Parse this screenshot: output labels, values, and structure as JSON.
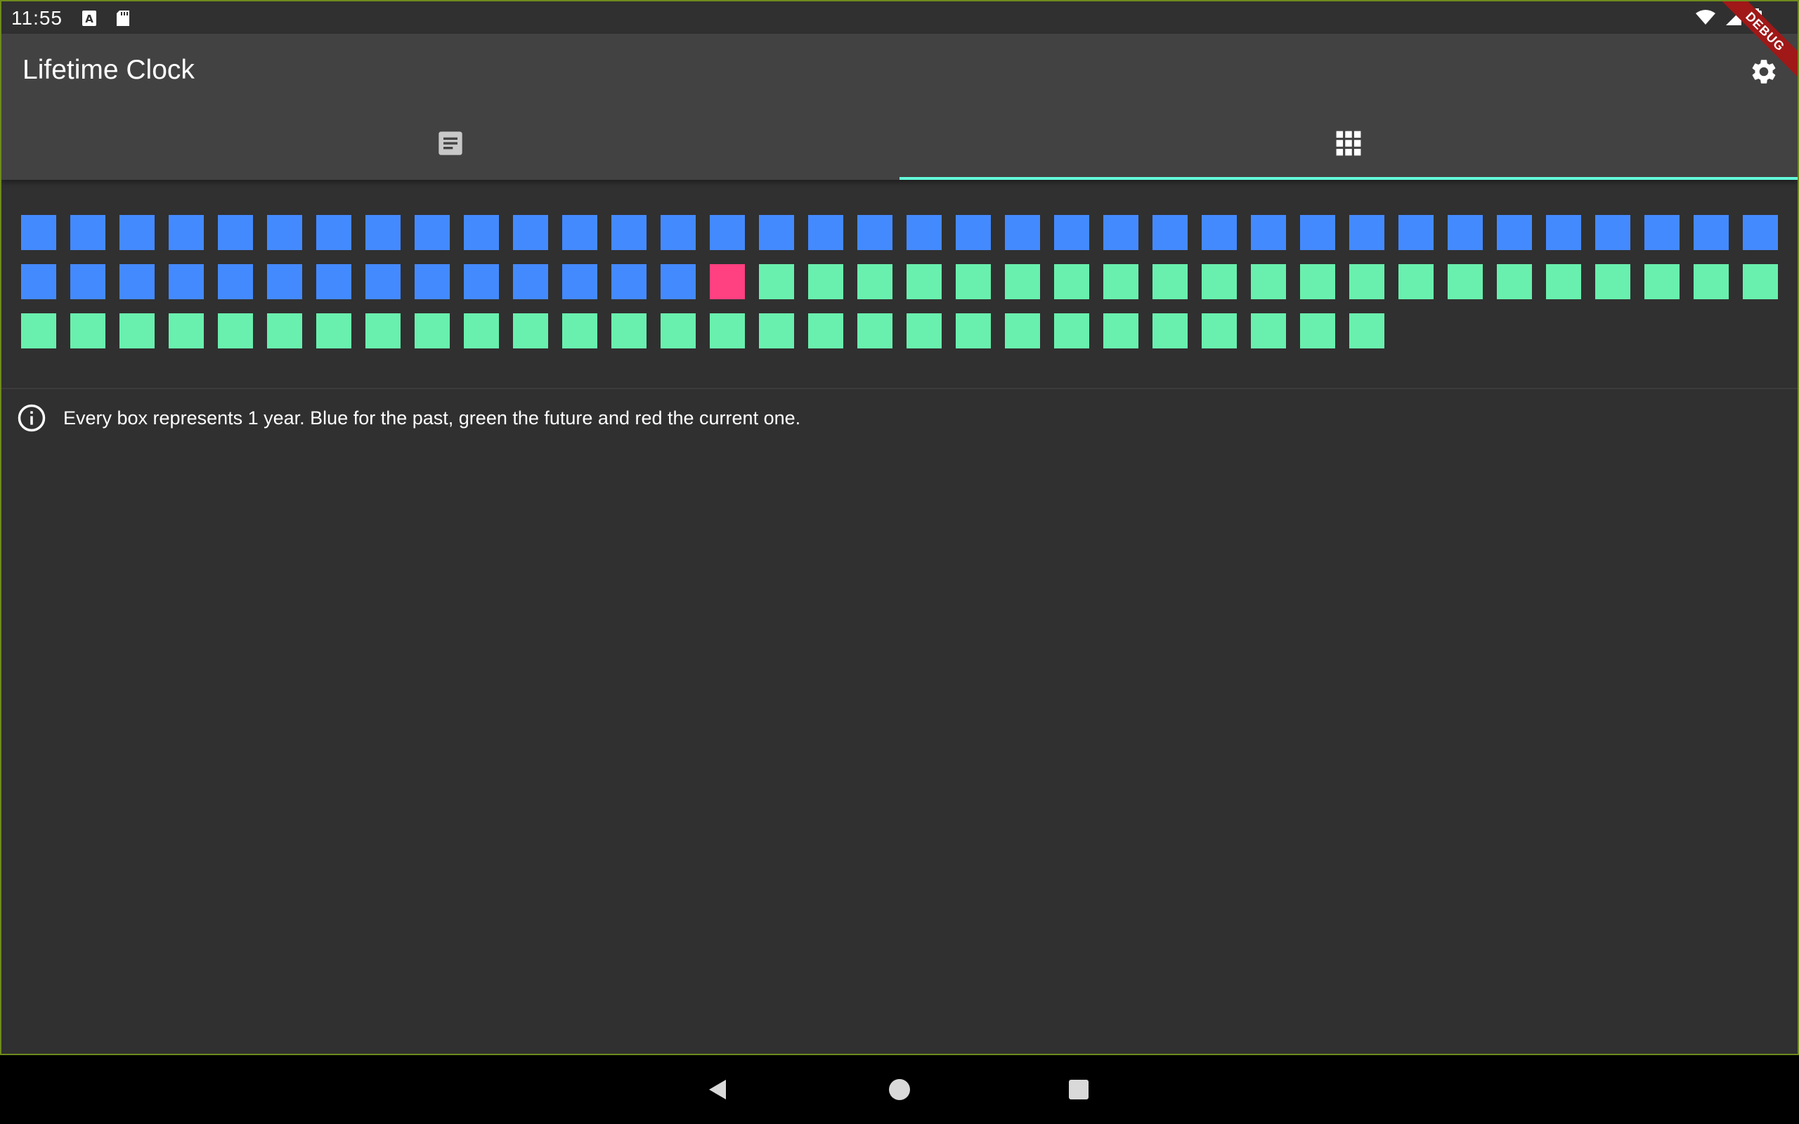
{
  "status_bar": {
    "time": "11:55"
  },
  "debug_banner": "DEBUG",
  "app_bar": {
    "title": "Lifetime Clock",
    "tabs": [
      {
        "icon": "article-icon",
        "selected": false
      },
      {
        "icon": "apps-grid-icon",
        "selected": true
      }
    ],
    "tab_indicator_color": "#64ffda"
  },
  "life_grid": {
    "past_years": 50,
    "current_years": 1,
    "future_years": 49,
    "past_color": "#448aff",
    "current_color": "#ff4081",
    "future_color": "#69f0ae"
  },
  "info": {
    "icon": "info-outline-icon",
    "text": "Every box represents 1 year. Blue for the past, green the future and red the current one."
  },
  "nav_bar": {
    "buttons": [
      "back-icon",
      "home-icon",
      "recents-icon"
    ]
  }
}
